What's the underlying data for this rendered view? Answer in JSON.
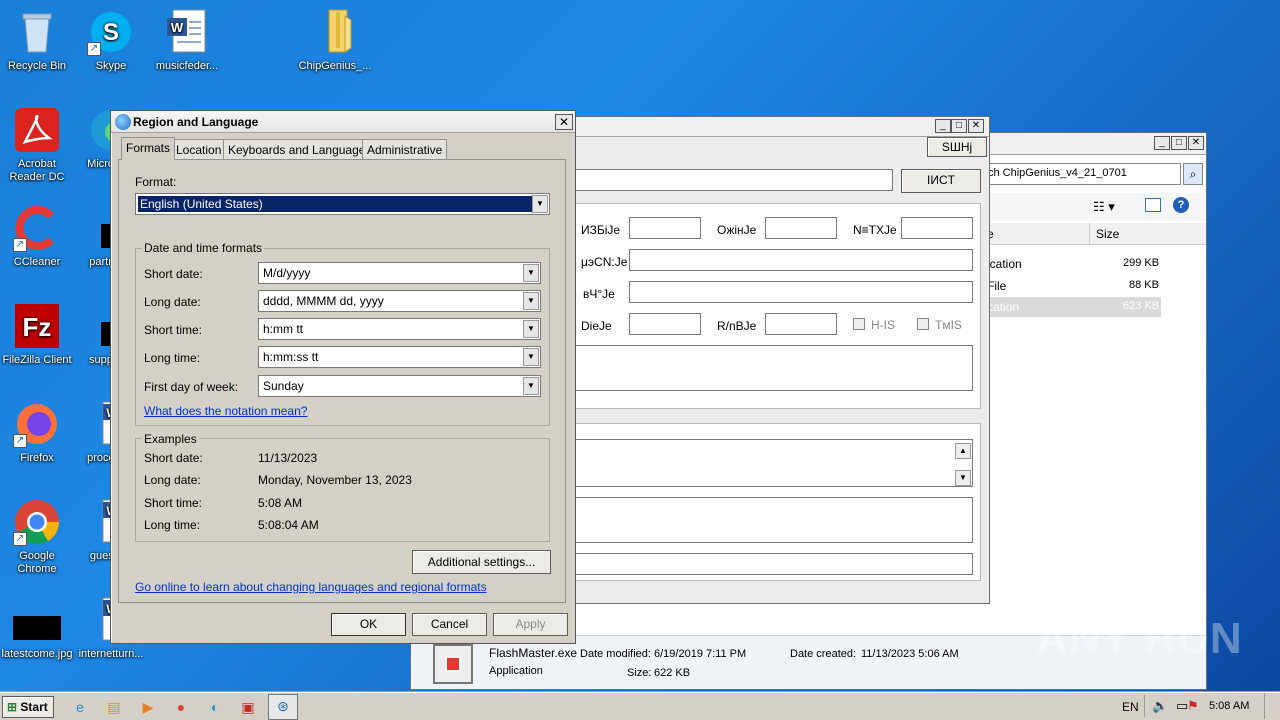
{
  "desktop": {
    "icons": [
      {
        "label": "Recycle Bin",
        "icon": "recycle-bin-icon"
      },
      {
        "label": "Skype",
        "icon": "skype-icon"
      },
      {
        "label": "musicfeder...",
        "icon": "word-doc-icon"
      },
      {
        "label": "ChipGenius_...",
        "icon": "folder-zip-icon"
      },
      {
        "label": "Acrobat Reader DC",
        "icon": "acrobat-icon"
      },
      {
        "label": "Microso...",
        "icon": "edge-icon"
      },
      {
        "label": "CCleaner",
        "icon": "ccleaner-icon"
      },
      {
        "label": "partner...",
        "icon": "black-file-icon"
      },
      {
        "label": "FileZilla Client",
        "icon": "filezilla-icon"
      },
      {
        "label": "supplie...",
        "icon": "black-file-icon"
      },
      {
        "label": "Firefox",
        "icon": "firefox-icon"
      },
      {
        "label": "process...",
        "icon": "word-doc-icon"
      },
      {
        "label": "Google Chrome",
        "icon": "chrome-icon"
      },
      {
        "label": "guestb...",
        "icon": "word-doc-icon"
      },
      {
        "label": "latestcome.jpg",
        "icon": "black-file-icon"
      },
      {
        "label": "internetturn...",
        "icon": "word-doc-icon"
      }
    ]
  },
  "chipgenius_window": {
    "button_top": "SШHj",
    "button_second": "IИCT",
    "labels": {
      "l1": "ИЗБiJe",
      "l2": "OжiнJe",
      "l3": "N≡TXJe",
      "l4": "μэCN:Je",
      "l5": "вЧ°Je",
      "l6": "DieJe",
      "l7": "R/nBJe",
      "l8": "H-IS",
      "l9": "TмIS"
    }
  },
  "explorer_window": {
    "search_text": "ch ChipGenius_v4_21_0701",
    "col_name": "e",
    "col_size": "Size",
    "rows": [
      {
        "type": "ication",
        "size": "299 KB"
      },
      {
        "type": "File",
        "size": "88 KB"
      },
      {
        "type": "cation",
        "size": "623 KB"
      }
    ],
    "details": {
      "filename": "FlashMaster.exe",
      "type": "Application",
      "date_modified_label": "Date modified:",
      "date_modified": "6/19/2019 7:11 PM",
      "date_created_label": "Date created:",
      "date_created": "11/13/2023 5:06 AM",
      "size_label": "Size:",
      "size": "622 KB"
    }
  },
  "dialog": {
    "title": "Region and Language",
    "tabs": [
      "Formats",
      "Location",
      "Keyboards and Languages",
      "Administrative"
    ],
    "format_label": "Format:",
    "format_value": "English (United States)",
    "dt_group": "Date and time formats",
    "rows": [
      {
        "label": "Short date:",
        "value": "M/d/yyyy"
      },
      {
        "label": "Long date:",
        "value": "dddd, MMMM dd, yyyy"
      },
      {
        "label": "Short time:",
        "value": "h:mm tt"
      },
      {
        "label": "Long time:",
        "value": "h:mm:ss tt"
      },
      {
        "label": "First day of week:",
        "value": "Sunday"
      }
    ],
    "notation_link": "What does the notation mean?",
    "examples_group": "Examples",
    "examples": [
      {
        "label": "Short date:",
        "value": "11/13/2023"
      },
      {
        "label": "Long date:",
        "value": "Monday, November 13, 2023"
      },
      {
        "label": "Short time:",
        "value": "5:08 AM"
      },
      {
        "label": "Long time:",
        "value": "5:08:04 AM"
      }
    ],
    "additional_settings": "Additional settings...",
    "online_link": "Go online to learn about changing languages and regional formats",
    "ok": "OK",
    "cancel": "Cancel",
    "apply": "Apply"
  },
  "taskbar": {
    "start": "Start",
    "lang": "EN",
    "clock": "5:08 AM"
  },
  "watermark": "ANY RUN",
  "colors": {
    "selection": "#0a246a",
    "link": "#0033cc",
    "desktop": "#1e88e5"
  }
}
